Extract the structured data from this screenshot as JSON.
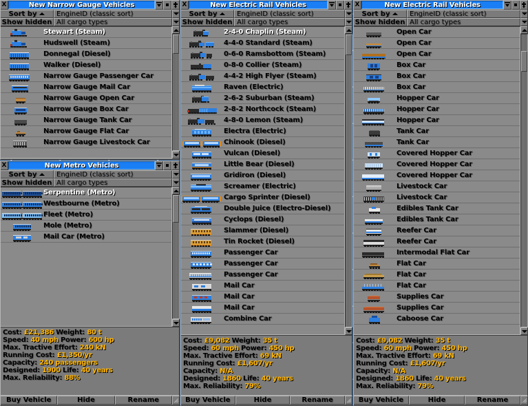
{
  "colors": {
    "window_bg": "#7b7b7b",
    "title_active": "#1a7ef4",
    "list_bg": "#8a8a8a",
    "value_text": "#ffb400",
    "selected_text": "#ffffff",
    "water": "#35649b"
  },
  "windows": [
    {
      "id": "narrow-gauge",
      "title": "New Narrow Gauge Vehicles",
      "close_label": "X",
      "sort_button": "Sort by",
      "sort_direction": "ascending",
      "sort_value": "EngineID (classic sort)",
      "hidden_button": "Show hidden",
      "cargo_value": "All cargo types",
      "items": [
        {
          "name": "Stewart (Steam)",
          "selected": true,
          "sprite": "loco-blue-steam"
        },
        {
          "name": "Hudswell (Steam)",
          "selected": false,
          "sprite": "loco-blue-steam"
        },
        {
          "name": "Donnegal (Diesel)",
          "selected": false,
          "sprite": "loco-blue-diesel"
        },
        {
          "name": "Walker (Diesel)",
          "selected": false,
          "sprite": "loco-blue-diesel"
        },
        {
          "name": "Narrow Gauge Passenger Car",
          "selected": false,
          "sprite": "car-passenger"
        },
        {
          "name": "Narrow Gauge Mail Car",
          "selected": false,
          "sprite": "car-mail"
        },
        {
          "name": "Narrow Gauge Open Car",
          "selected": false,
          "sprite": "car-open"
        },
        {
          "name": "Narrow Gauge Box Car",
          "selected": false,
          "sprite": "car-box"
        },
        {
          "name": "Narrow Gauge Tank Car",
          "selected": false,
          "sprite": "car-tank"
        },
        {
          "name": "Narrow Gauge Flat Car",
          "selected": false,
          "sprite": "car-flat"
        },
        {
          "name": "Narrow Gauge Livestock Car",
          "selected": false,
          "sprite": "car-livestock"
        }
      ],
      "info": null,
      "footer": null
    },
    {
      "id": "metro",
      "title": "New Metro Vehicles",
      "close_label": "X",
      "sort_button": "Sort by",
      "sort_direction": "ascending",
      "sort_value": "EngineID (classic sort)",
      "hidden_button": "Show hidden",
      "cargo_value": "All cargo types",
      "items": [
        {
          "name": "Serpentine (Metro)",
          "selected": true,
          "sprite": "metro-dark"
        },
        {
          "name": "Westbourne (Metro)",
          "selected": false,
          "sprite": "metro-blue"
        },
        {
          "name": "Fleet (Metro)",
          "selected": false,
          "sprite": "metro-light"
        },
        {
          "name": "Mole (Metro)",
          "selected": false,
          "sprite": "metro-short"
        },
        {
          "name": "Mail Car (Metro)",
          "selected": false,
          "sprite": "metro-mail"
        }
      ],
      "info": {
        "cost_label": "Cost:",
        "cost_value": "£21,386",
        "weight_label": "Weight:",
        "weight_value": "80 t",
        "speed_label": "Speed:",
        "speed_value": "40 mph",
        "power_label": "Power:",
        "power_value": "600 hp",
        "te_label": "Max. Tractive Effort:",
        "te_value": "240 kN",
        "running_label": "Running Cost:",
        "running_value": "£1,350/yr",
        "capacity_label": "Capacity:",
        "capacity_value": "240 passengers",
        "designed_label": "Designed:",
        "designed_value": "1900",
        "life_label": "Life:",
        "life_value": "40 years",
        "reliability_label": "Max. Reliability:",
        "reliability_value": "88%"
      },
      "footer": {
        "buy": "Buy Vehicle",
        "hide": "Hide",
        "rename": "Rename"
      }
    },
    {
      "id": "electric-left",
      "title": "New Electric Rail Vehicles",
      "close_label": "X",
      "sort_button": "Sort by",
      "sort_direction": "ascending",
      "sort_value": "EngineID (classic sort)",
      "hidden_button": "Show hidden",
      "cargo_value": "All cargo types",
      "items": [
        {
          "name": "2-4-0 Chaplin (Steam)",
          "selected": true,
          "sprite": "loco-steam-a"
        },
        {
          "name": "4-4-0 Standard (Steam)",
          "selected": false,
          "sprite": "loco-steam-b"
        },
        {
          "name": "0-6-0 Ramsbottom (Steam)",
          "selected": false,
          "sprite": "loco-steam-c"
        },
        {
          "name": "0-8-0 Collier (Steam)",
          "selected": false,
          "sprite": "loco-steam-d"
        },
        {
          "name": "4-4-2 High Flyer (Steam)",
          "selected": false,
          "sprite": "loco-steam-e"
        },
        {
          "name": "Raven (Electric)",
          "selected": false,
          "sprite": "loco-elec-a"
        },
        {
          "name": "2-6-2 Suburban (Steam)",
          "selected": false,
          "sprite": "loco-steam-f"
        },
        {
          "name": "2-8-2 Northcock (Steam)",
          "selected": false,
          "sprite": "loco-steam-g"
        },
        {
          "name": "4-8-0 Lemon (Steam)",
          "selected": false,
          "sprite": "loco-steam-h"
        },
        {
          "name": "Electra (Electric)",
          "selected": false,
          "sprite": "loco-elec-b"
        },
        {
          "name": "Chinook (Diesel)",
          "selected": false,
          "sprite": "loco-diesel-twin"
        },
        {
          "name": "Vulcan (Diesel)",
          "selected": false,
          "sprite": "loco-diesel-a"
        },
        {
          "name": "Little Bear (Diesel)",
          "selected": false,
          "sprite": "loco-diesel-b"
        },
        {
          "name": "Gridiron (Diesel)",
          "selected": false,
          "sprite": "loco-diesel-c"
        },
        {
          "name": "Screamer (Electric)",
          "selected": false,
          "sprite": "loco-elec-c"
        },
        {
          "name": "Cargo Sprinter (Diesel)",
          "selected": false,
          "sprite": "loco-diesel-twin2"
        },
        {
          "name": "Double Juice (Electro-Diesel)",
          "selected": false,
          "sprite": "loco-elecdiesel"
        },
        {
          "name": "Cyclops (Diesel)",
          "selected": false,
          "sprite": "loco-diesel-d"
        },
        {
          "name": "Slammer (Diesel)",
          "selected": false,
          "sprite": "dmu-slammer"
        },
        {
          "name": "Tin Rocket (Diesel)",
          "selected": false,
          "sprite": "dmu-tinrocket"
        },
        {
          "name": "Passenger Car",
          "selected": false,
          "sprite": "pax-a"
        },
        {
          "name": "Passenger Car",
          "selected": false,
          "sprite": "pax-b"
        },
        {
          "name": "Passenger Car",
          "selected": false,
          "sprite": "pax-c"
        },
        {
          "name": "Mail Car",
          "selected": false,
          "sprite": "mail-a"
        },
        {
          "name": "Mail Car",
          "selected": false,
          "sprite": "mail-b"
        },
        {
          "name": "Mail Car",
          "selected": false,
          "sprite": "mail-c"
        },
        {
          "name": "Combine Car",
          "selected": false,
          "sprite": "combine"
        }
      ],
      "info": {
        "cost_label": "Cost:",
        "cost_value": "£9,082",
        "weight_label": "Weight:",
        "weight_value": "35 t",
        "speed_label": "Speed:",
        "speed_value": "60 mph",
        "power_label": "Power:",
        "power_value": "450 hp",
        "te_label": "Max. Tractive Effort:",
        "te_value": "69 kN",
        "running_label": "Running Cost:",
        "running_value": "£1,607/yr",
        "capacity_label": "Capacity:",
        "capacity_value": "N/A",
        "designed_label": "Designed:",
        "designed_value": "1860",
        "life_label": "Life:",
        "life_value": "40 years",
        "reliability_label": "Max. Reliability:",
        "reliability_value": "79%"
      },
      "footer": {
        "buy": "Buy Vehicle",
        "hide": "Hide",
        "rename": "Rename"
      }
    },
    {
      "id": "electric-right",
      "title": "New Electric Rail Vehicles",
      "close_label": "X",
      "sort_button": "Sort by",
      "sort_direction": "ascending",
      "sort_value": "EngineID (classic sort)",
      "hidden_button": "Show hidden",
      "cargo_value": "All cargo types",
      "items": [
        {
          "name": "Open Car",
          "selected": false,
          "sprite": "open-a"
        },
        {
          "name": "Open Car",
          "selected": false,
          "sprite": "open-b"
        },
        {
          "name": "Open Car",
          "selected": false,
          "sprite": "open-c"
        },
        {
          "name": "Box Car",
          "selected": false,
          "sprite": "box-a"
        },
        {
          "name": "Box Car",
          "selected": false,
          "sprite": "box-b"
        },
        {
          "name": "Box Car",
          "selected": false,
          "sprite": "box-c"
        },
        {
          "name": "Hopper Car",
          "selected": false,
          "sprite": "hop-a"
        },
        {
          "name": "Hopper Car",
          "selected": false,
          "sprite": "hop-b"
        },
        {
          "name": "Hopper Car",
          "selected": false,
          "sprite": "hop-c"
        },
        {
          "name": "Tank Car",
          "selected": false,
          "sprite": "tank-a"
        },
        {
          "name": "Tank Car",
          "selected": false,
          "sprite": "tank-b"
        },
        {
          "name": "Covered Hopper Car",
          "selected": false,
          "sprite": "chop-a"
        },
        {
          "name": "Covered Hopper Car",
          "selected": false,
          "sprite": "chop-b"
        },
        {
          "name": "Covered Hopper Car",
          "selected": false,
          "sprite": "chop-c"
        },
        {
          "name": "Livestock Car",
          "selected": false,
          "sprite": "live-a"
        },
        {
          "name": "Livestock Car",
          "selected": false,
          "sprite": "live-b"
        },
        {
          "name": "Edibles Tank Car",
          "selected": false,
          "sprite": "edible-a"
        },
        {
          "name": "Edibles Tank Car",
          "selected": false,
          "sprite": "edible-b"
        },
        {
          "name": "Reefer Car",
          "selected": false,
          "sprite": "reefer-a"
        },
        {
          "name": "Reefer Car",
          "selected": false,
          "sprite": "reefer-b"
        },
        {
          "name": "Intermodal Flat Car",
          "selected": false,
          "sprite": "intermodal"
        },
        {
          "name": "Flat Car",
          "selected": false,
          "sprite": "flat-a"
        },
        {
          "name": "Flat Car",
          "selected": false,
          "sprite": "flat-b"
        },
        {
          "name": "Flat Car",
          "selected": false,
          "sprite": "flat-c"
        },
        {
          "name": "Supplies Car",
          "selected": false,
          "sprite": "sup-a"
        },
        {
          "name": "Supplies Car",
          "selected": false,
          "sprite": "sup-b"
        },
        {
          "name": "Caboose Car",
          "selected": false,
          "sprite": "caboose"
        }
      ],
      "info": {
        "cost_label": "Cost:",
        "cost_value": "£9,082",
        "weight_label": "Weight:",
        "weight_value": "35 t",
        "speed_label": "Speed:",
        "speed_value": "60 mph",
        "power_label": "Power:",
        "power_value": "450 hp",
        "te_label": "Max. Tractive Effort:",
        "te_value": "69 kN",
        "running_label": "Running Cost:",
        "running_value": "£1,607/yr",
        "capacity_label": "Capacity:",
        "capacity_value": "N/A",
        "designed_label": "Designed:",
        "designed_value": "1860",
        "life_label": "Life:",
        "life_value": "40 years",
        "reliability_label": "Max. Reliability:",
        "reliability_value": "79%"
      },
      "footer": {
        "buy": "Buy Vehicle",
        "hide": "Hide",
        "rename": "Rename"
      }
    }
  ],
  "icons": {
    "close": "close-icon",
    "sticky": "sticky-pin-icon",
    "shade": "shade-icon",
    "debug": "debug-box-icon",
    "scroll_up": "scroll-up-icon",
    "scroll_down": "scroll-down-icon",
    "dropdown": "chevron-down-icon",
    "resize": "resize-grip-icon"
  }
}
